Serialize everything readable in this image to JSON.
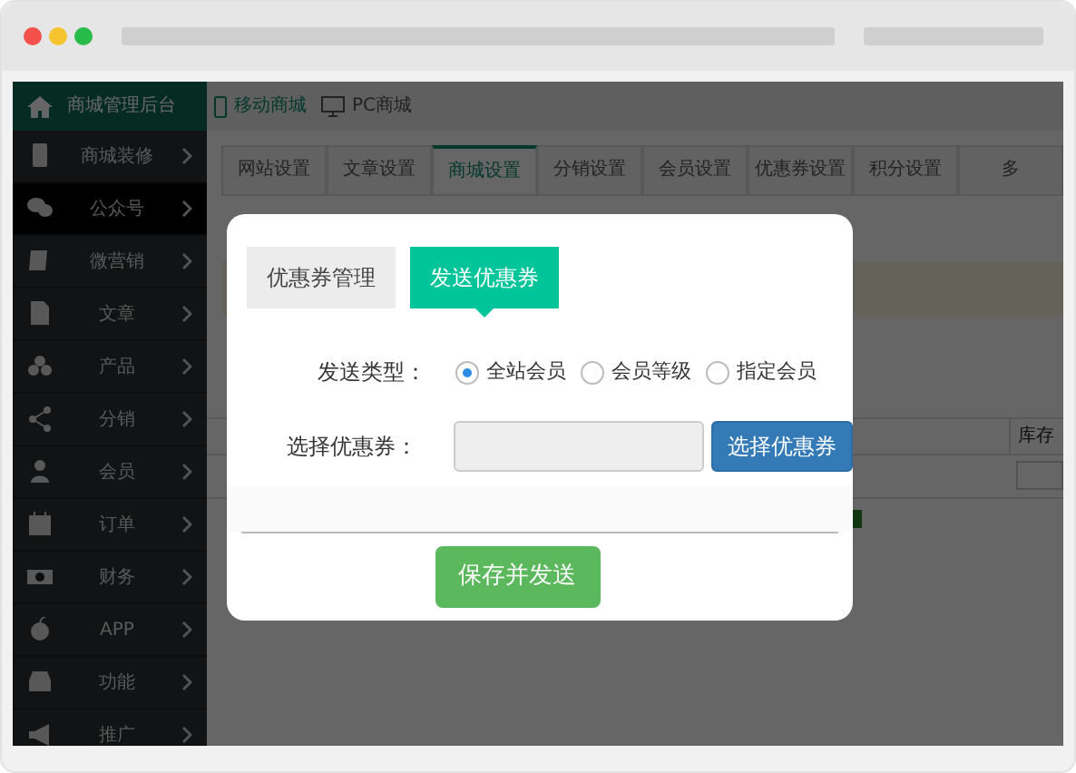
{
  "header": {
    "brand": "商城管理后台",
    "links": [
      {
        "label": "移动商城",
        "selected": true
      },
      {
        "label": "PC商城",
        "selected": false
      }
    ]
  },
  "sidebar": {
    "items": [
      {
        "label": "商城装修",
        "selected": false
      },
      {
        "label": "公众号",
        "selected": true
      },
      {
        "label": "微营销",
        "selected": false
      },
      {
        "label": "文章",
        "selected": false
      },
      {
        "label": "产品",
        "selected": false
      },
      {
        "label": "分销",
        "selected": false
      },
      {
        "label": "会员",
        "selected": false
      },
      {
        "label": "订单",
        "selected": false
      },
      {
        "label": "财务",
        "selected": false
      },
      {
        "label": "APP",
        "selected": false
      },
      {
        "label": "功能",
        "selected": false
      },
      {
        "label": "推广",
        "selected": false
      }
    ]
  },
  "tabs": [
    {
      "label": "网站设置",
      "selected": false
    },
    {
      "label": "文章设置",
      "selected": false
    },
    {
      "label": "商城设置",
      "selected": true
    },
    {
      "label": "分销设置",
      "selected": false
    },
    {
      "label": "会员设置",
      "selected": false
    },
    {
      "label": "优惠券设置",
      "selected": false
    },
    {
      "label": "积分设置",
      "selected": false
    },
    {
      "label": "多",
      "selected": false
    }
  ],
  "background_table": {
    "columns": [
      "库存"
    ]
  },
  "dialog": {
    "tabs": [
      {
        "label": "优惠券管理",
        "selected": false
      },
      {
        "label": "发送优惠券",
        "selected": true
      }
    ],
    "send_type": {
      "label": "发送类型：",
      "options": [
        {
          "label": "全站会员",
          "selected": true
        },
        {
          "label": "会员等级",
          "selected": false
        },
        {
          "label": "指定会员",
          "selected": false
        }
      ]
    },
    "coupon": {
      "label": "选择优惠券：",
      "button": "选择优惠券"
    },
    "save_button": "保存并发送"
  }
}
